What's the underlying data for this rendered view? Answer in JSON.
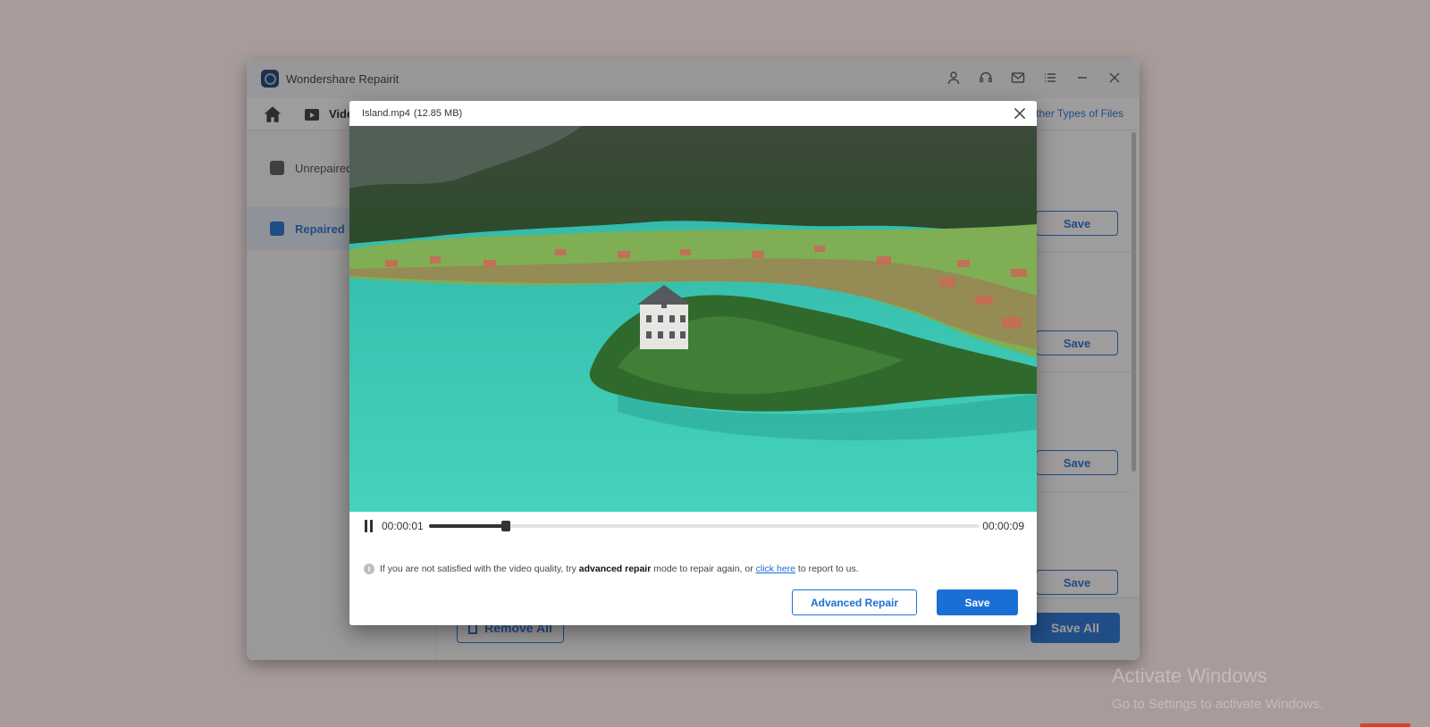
{
  "app": {
    "title": "Wondershare Repairit",
    "nav": {
      "video_label": "Video",
      "other_types": "Other Types of Files"
    },
    "sidebar": [
      {
        "label": "Unrepaired",
        "active": false
      },
      {
        "label": "Repaired",
        "active": true
      }
    ],
    "row_save_label": "Save",
    "remove_all_label": "Remove All",
    "save_all_label": "Save All",
    "window_icons": [
      "account-icon",
      "support-icon",
      "mail-icon",
      "menu-icon",
      "minimize-icon",
      "close-icon"
    ]
  },
  "preview": {
    "file_name": "Island.mp4",
    "file_size": "(12.85  MB)",
    "current_time": "00:00:01",
    "total_time": "00:00:09",
    "progress_fraction": 0.14,
    "note": {
      "prefix": "If you are not satisfied with the video quality, try ",
      "bold": "advanced repair",
      "middle": " mode to repair again, or ",
      "link": "click here",
      "suffix": " to report to us."
    },
    "advanced_repair_label": "Advanced Repair",
    "save_label": "Save"
  },
  "watermark": {
    "line1": "Activate Windows",
    "line2": "Go to Settings to activate Windows."
  },
  "colors": {
    "accent": "#1a6fd6",
    "lake": "#3ac6b3"
  }
}
